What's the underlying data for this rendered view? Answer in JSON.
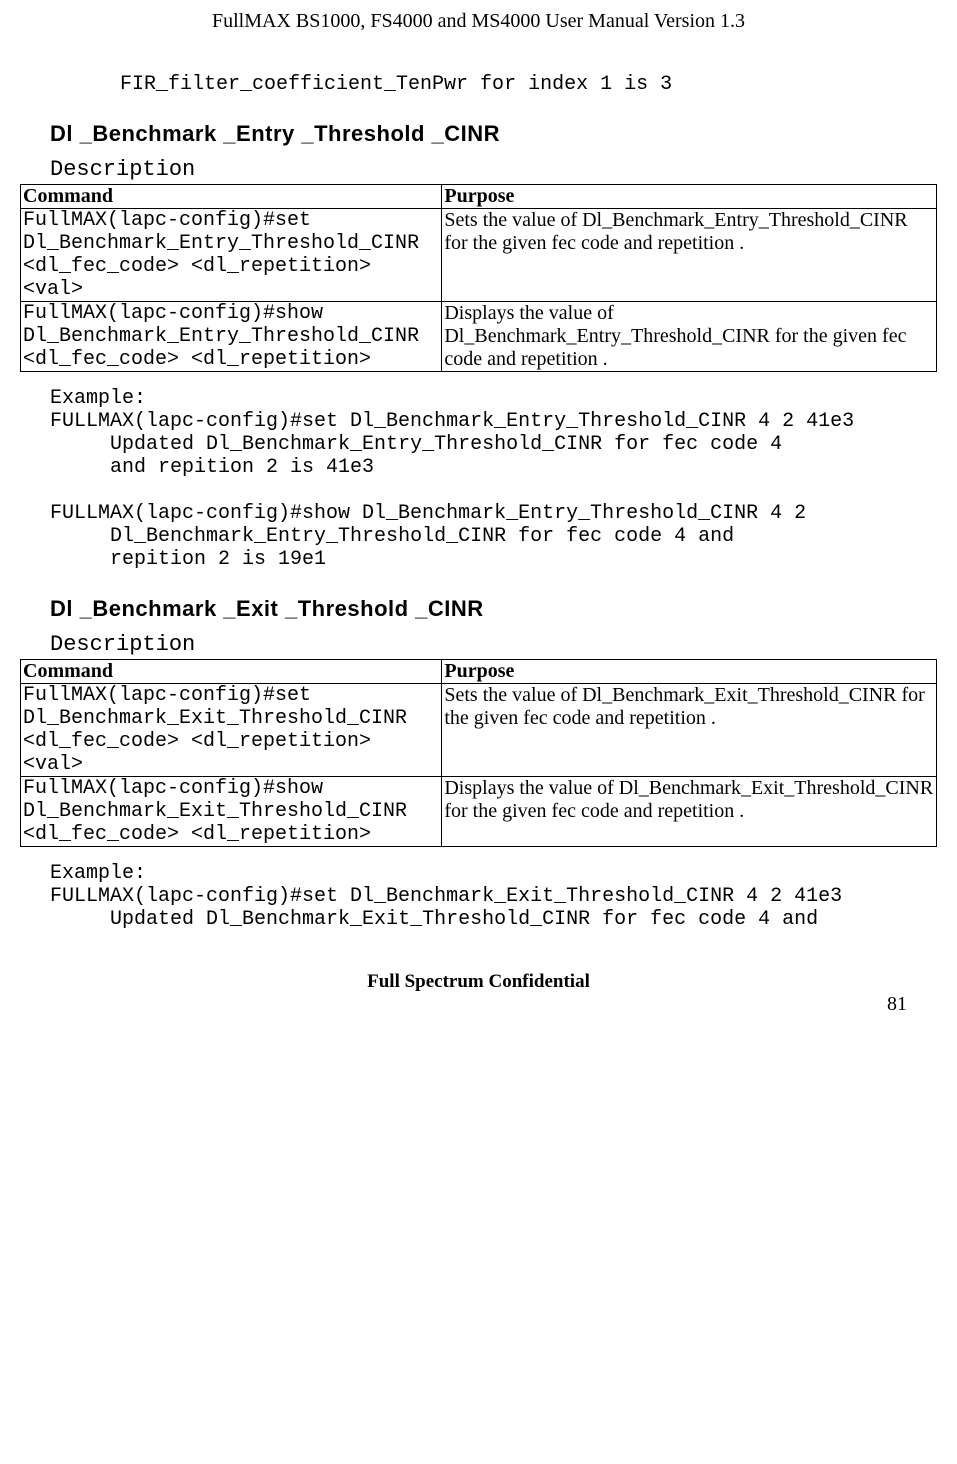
{
  "header": "FullMAX BS1000, FS4000 and MS4000 User Manual Version 1.3",
  "intro_line": "FIR_filter_coefficient_TenPwr for index 1 is 3",
  "section1": {
    "heading": "Dl _Benchmark _Entry _Threshold _CINR",
    "description_label": "Description",
    "table": {
      "headers": {
        "command": "Command",
        "purpose": "Purpose"
      },
      "rows": [
        {
          "command": "FullMAX(lapc-config)#set Dl_Benchmark_Entry_Threshold_CINR  <dl_fec_code>  <dl_repetition> <val>",
          "purpose": "Sets the value of Dl_Benchmark_Entry_Threshold_CINR   for the given fec code and repetition ."
        },
        {
          "command": "FullMAX(lapc-config)#show Dl_Benchmark_Entry_Threshold_CINR  <dl_fec_code>  <dl_repetition>",
          "purpose": "Displays the value of Dl_Benchmark_Entry_Threshold_CINR   for the given fec code and repetition ."
        }
      ]
    },
    "example": "Example:\nFULLMAX(lapc-config)#set Dl_Benchmark_Entry_Threshold_CINR 4 2 41e3\n     Updated Dl_Benchmark_Entry_Threshold_CINR for fec code 4\n     and repition 2 is 41e3\n\nFULLMAX(lapc-config)#show Dl_Benchmark_Entry_Threshold_CINR 4 2\n     Dl_Benchmark_Entry_Threshold_CINR for fec code 4 and\n     repition 2 is 19e1"
  },
  "section2": {
    "heading": "Dl _Benchmark _Exit _Threshold _CINR",
    "description_label": "Description",
    "table": {
      "headers": {
        "command": "Command",
        "purpose": "Purpose"
      },
      "rows": [
        {
          "command": "FullMAX(lapc-config)#set Dl_Benchmark_Exit_Threshold_CINR  <dl_fec_code>  <dl_repetition> <val>",
          "purpose": "Sets the value of Dl_Benchmark_Exit_Threshold_CINR   for the given fec code and repetition ."
        },
        {
          "command": "FullMAX(lapc-config)#show Dl_Benchmark_Exit_Threshold_CINR  <dl_fec_code>  <dl_repetition>",
          "purpose": "Displays the value of Dl_Benchmark_Exit_Threshold_CINR   for the given fec code and repetition ."
        }
      ]
    },
    "example": "Example:\nFULLMAX(lapc-config)#set Dl_Benchmark_Exit_Threshold_CINR 4 2 41e3\n     Updated Dl_Benchmark_Exit_Threshold_CINR for fec code 4 and"
  },
  "footer": {
    "text": "Full Spectrum Confidential",
    "page_number": "81"
  }
}
